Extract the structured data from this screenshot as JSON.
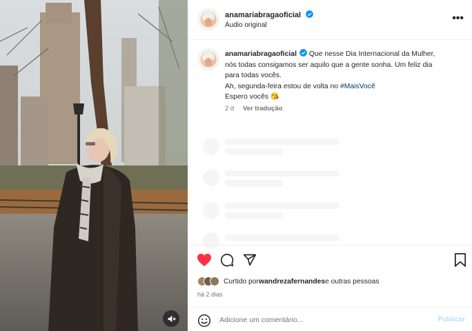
{
  "post": {
    "username": "anamariabragaoficial",
    "audio_label": "Áudio original",
    "more_label": "•••",
    "caption": {
      "line1": "Que nesse Dia Internacional da Mulher,",
      "line2": "nós todas consigamos ser aquilo que a gente sonha. Um feliz dia",
      "line3": "para todas vocês.",
      "line4_prefix": "Ah, segunda-feira estou de volta no ",
      "hashtag": "#MaisVocê",
      "line5": "Espero vocês 😘"
    },
    "age": "2 d",
    "translate_label": "Ver tradução",
    "liked_by_prefix": "Curtido por ",
    "liked_by_user": "wandrezafernandes",
    "liked_by_suffix": " e outras pessoas",
    "date_label": "há 2 dias"
  },
  "comment": {
    "placeholder": "Adicione um comentário...",
    "publish_label": "Publicar"
  },
  "colors": {
    "like_red": "#ff3040",
    "verified_blue": "#0095f6",
    "publish_disabled": "#b2dffc"
  },
  "icons": [
    "verified-badge-icon",
    "heart-icon",
    "comment-icon",
    "share-icon",
    "bookmark-icon",
    "emoji-icon",
    "mute-icon"
  ]
}
